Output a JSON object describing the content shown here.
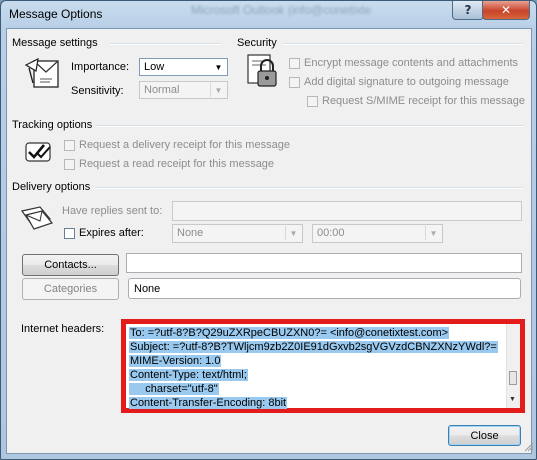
{
  "window": {
    "title": "Message Options",
    "background_title": "Microsoft Outlook (info@conetixte",
    "help_glyph": "?",
    "close_glyph": "✕"
  },
  "message_settings": {
    "heading": "Message settings",
    "importance_label": "Importance:",
    "importance_value": "Low",
    "sensitivity_label": "Sensitivity:",
    "sensitivity_value": "Normal"
  },
  "security": {
    "heading": "Security",
    "options": [
      {
        "label": "Encrypt message contents and attachments",
        "checked": false,
        "enabled": false
      },
      {
        "label": "Add digital signature to outgoing message",
        "checked": false,
        "enabled": false
      },
      {
        "label": "Request S/MIME receipt for this message",
        "checked": false,
        "enabled": false
      }
    ]
  },
  "tracking": {
    "heading": "Tracking options",
    "options": [
      {
        "label": "Request a delivery receipt for this message",
        "checked": false,
        "enabled": false
      },
      {
        "label": "Request a read receipt for this message",
        "checked": false,
        "enabled": false
      }
    ]
  },
  "delivery": {
    "heading": "Delivery options",
    "replies_label": "Have replies sent to:",
    "replies_value": "",
    "expires_label": "Expires after:",
    "expires_checked": false,
    "expires_date": "None",
    "expires_time": "00:00"
  },
  "contacts": {
    "button_label": "Contacts...",
    "value": ""
  },
  "categories": {
    "button_label": "Categories",
    "value": "None"
  },
  "internet_headers": {
    "label": "Internet headers:",
    "lines": [
      "To: =?utf-8?B?Q29uZXRpeCBUZXN0?= <info@conetixtest.com>",
      "Subject: =?utf-8?B?TWljcm9zb2Z0IE91dGxvb2sgVGVzdCBNZXNzYWdl?=",
      "MIME-Version: 1.0",
      "Content-Type: text/html;",
      "     charset=\"utf-8\"",
      "Content-Transfer-Encoding: 8bit"
    ]
  },
  "footer": {
    "close_label": "Close"
  },
  "colors": {
    "highlight_border": "#e21b1b",
    "selection": "#99c9ef"
  }
}
